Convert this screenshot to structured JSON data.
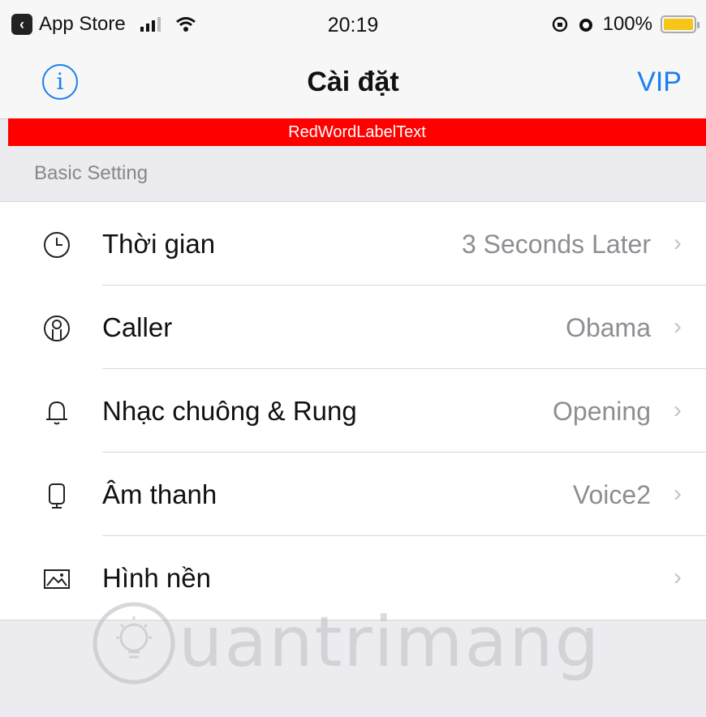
{
  "status_bar": {
    "back_app": "App Store",
    "time": "20:19",
    "battery": "100%"
  },
  "nav": {
    "title": "Cài đặt",
    "right_button": "VIP",
    "info_glyph": "i"
  },
  "banner": {
    "text": "RedWordLabelText"
  },
  "section": {
    "header": "Basic Setting"
  },
  "rows": [
    {
      "icon": "clock-icon",
      "label": "Thời gian",
      "value": "3 Seconds Later"
    },
    {
      "icon": "person-icon",
      "label": "Caller",
      "value": "Obama"
    },
    {
      "icon": "bell-icon",
      "label": "Nhạc chuông & Rung",
      "value": "Opening"
    },
    {
      "icon": "phone-icon",
      "label": "Âm thanh",
      "value": "Voice2"
    },
    {
      "icon": "image-icon",
      "label": "Hình nền",
      "value": ""
    }
  ],
  "watermark": "uantrimang",
  "colors": {
    "accent": "#1a7ff0",
    "banner": "#ff0000",
    "battery": "#f5c518"
  }
}
